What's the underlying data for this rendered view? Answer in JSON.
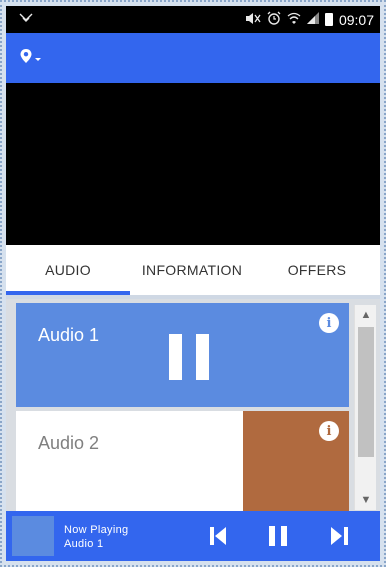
{
  "status_bar": {
    "left_icon": "vibrate-icon",
    "icons": [
      "mute-icon",
      "alarm-icon",
      "wifi-icon",
      "signal-icon",
      "battery-icon"
    ],
    "time": "09:07"
  },
  "app_bar": {
    "location_icon": "location-pin-icon"
  },
  "tabs": [
    {
      "label": "AUDIO",
      "active": true
    },
    {
      "label": "INFORMATION",
      "active": false
    },
    {
      "label": "OFFERS",
      "active": false
    }
  ],
  "audio_list": [
    {
      "title": "Audio 1",
      "playing": true,
      "info_icon": "info-icon"
    },
    {
      "title": "Audio 2",
      "playing": false,
      "info_icon": "info-icon"
    }
  ],
  "player": {
    "now_playing_label": "Now Playing",
    "track": "Audio 1",
    "controls": [
      "previous-icon",
      "pause-icon",
      "next-icon"
    ]
  },
  "colors": {
    "primary": "#3366ee",
    "card_active": "#5b8be0",
    "thumb": "#b06a3f"
  }
}
